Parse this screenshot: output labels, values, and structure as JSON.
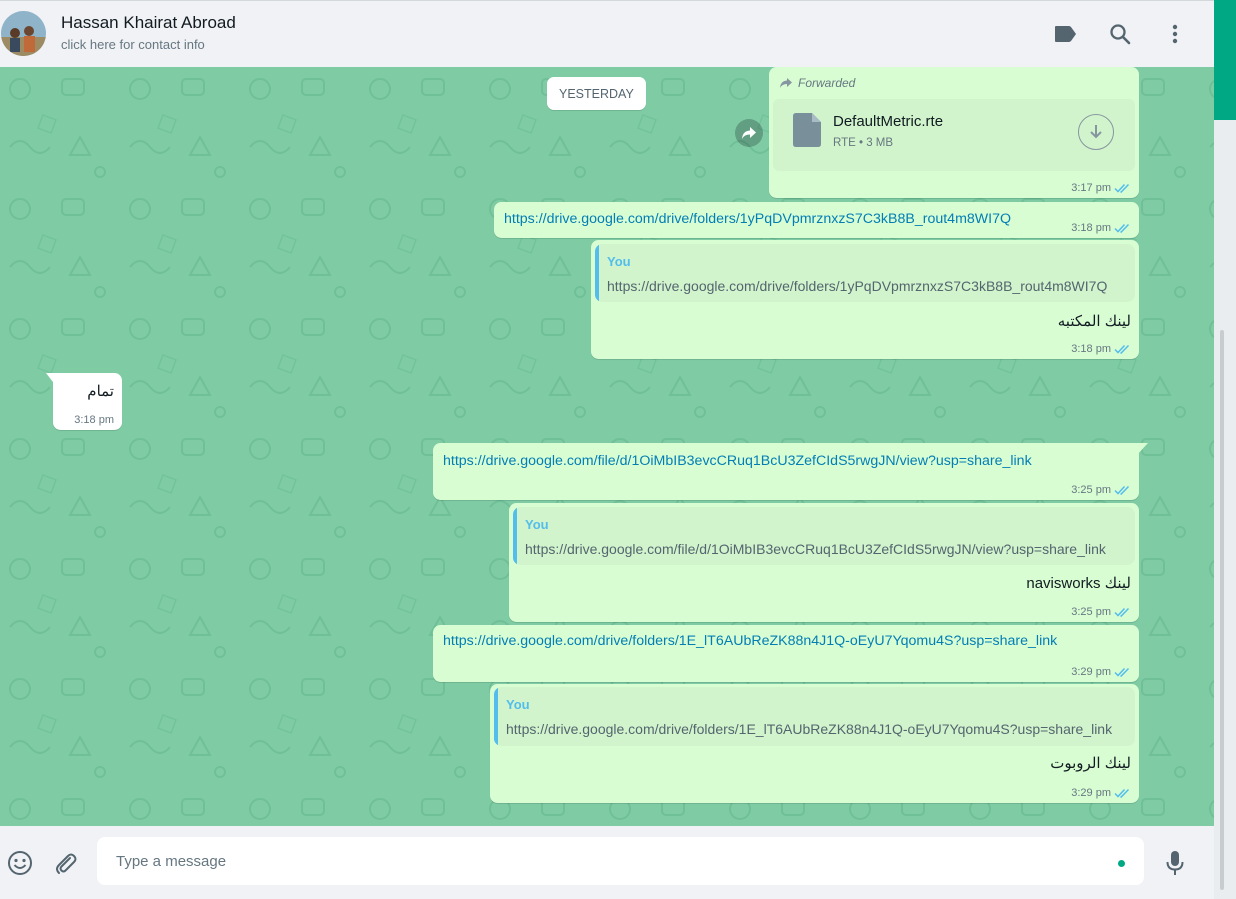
{
  "header": {
    "contact_name": "Hassan Khairat Abroad",
    "contact_sub": "click here for contact info",
    "icons": [
      "label-icon",
      "search-icon",
      "menu-icon"
    ]
  },
  "chat": {
    "date_chip": "YESTERDAY",
    "messages": [
      {
        "forwarded_label": "Forwarded",
        "file_name": "DefaultMetric.rte",
        "file_meta": "RTE • 3 MB",
        "time": "3:17 pm"
      },
      {
        "link": "https://drive.google.com/drive/folders/1yPqDVpmrznxzS7C3kB8B_rout4m8WI7Q",
        "time": "3:18 pm"
      },
      {
        "quote_author": "You",
        "quote_text": "https://drive.google.com/drive/folders/1yPqDVpmrznxzS7C3kB8B_rout4m8WI7Q",
        "text": "لينك المكتبه",
        "time": "3:18 pm"
      },
      {
        "text": "تمام",
        "time": "3:18 pm"
      },
      {
        "link": "https://drive.google.com/file/d/1OiMbIB3evcCRuq1BcU3ZefCIdS5rwgJN/view?usp=share_link",
        "time": "3:25 pm"
      },
      {
        "quote_author": "You",
        "quote_text": "https://drive.google.com/file/d/1OiMbIB3evcCRuq1BcU3ZefCIdS5rwgJN/view?usp=share_link",
        "text": "لينك navisworks",
        "time": "3:25 pm"
      },
      {
        "link": "https://drive.google.com/drive/folders/1E_lT6AUbReZK88n4J1Q-oEyU7Yqomu4S?usp=share_link",
        "time": "3:29 pm"
      },
      {
        "quote_author": "You",
        "quote_text": "https://drive.google.com/drive/folders/1E_lT6AUbReZK88n4J1Q-oEyU7Yqomu4S?usp=share_link",
        "text": "لينك الروبوت",
        "time": "3:29 pm"
      }
    ]
  },
  "footer": {
    "placeholder": "Type a message",
    "icons": [
      "emoji-icon",
      "attach-icon",
      "microphone-icon"
    ]
  },
  "colors": {
    "accent": "#00a884",
    "outgoing_bubble": "#d9fdd3",
    "incoming_bubble": "#ffffff",
    "chat_background": "#7fcca4",
    "link": "#027eb5",
    "read_ticks": "#53bdeb"
  }
}
